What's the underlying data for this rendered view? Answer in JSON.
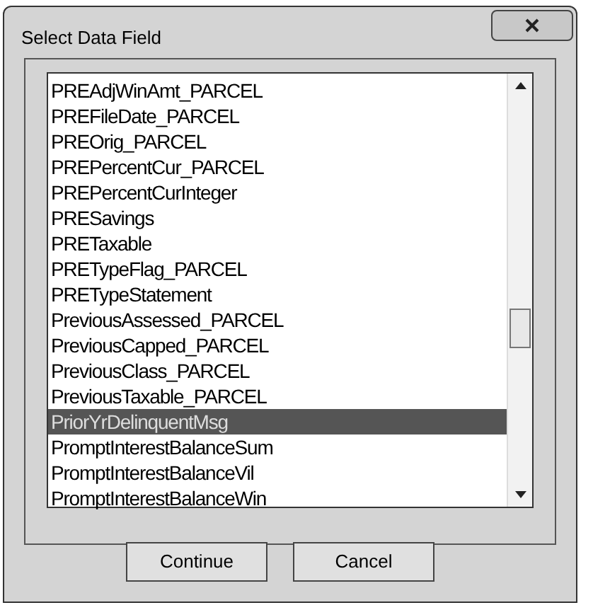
{
  "window": {
    "title": "Select Data Field"
  },
  "list": {
    "items": [
      {
        "label": "PREAdjWinAmt_PARCEL",
        "selected": false
      },
      {
        "label": "PREFileDate_PARCEL",
        "selected": false
      },
      {
        "label": "PREOrig_PARCEL",
        "selected": false
      },
      {
        "label": "PREPercentCur_PARCEL",
        "selected": false
      },
      {
        "label": "PREPercentCurInteger",
        "selected": false
      },
      {
        "label": "PRESavings",
        "selected": false
      },
      {
        "label": "PRETaxable",
        "selected": false
      },
      {
        "label": "PRETypeFlag_PARCEL",
        "selected": false
      },
      {
        "label": "PRETypeStatement",
        "selected": false
      },
      {
        "label": "PreviousAssessed_PARCEL",
        "selected": false
      },
      {
        "label": "PreviousCapped_PARCEL",
        "selected": false
      },
      {
        "label": "PreviousClass_PARCEL",
        "selected": false
      },
      {
        "label": "PreviousTaxable_PARCEL",
        "selected": false
      },
      {
        "label": "PriorYrDelinquentMsg",
        "selected": true
      },
      {
        "label": "PromptInterestBalanceSum",
        "selected": false
      },
      {
        "label": "PromptInterestBalanceVil",
        "selected": false
      },
      {
        "label": "PromptInterestBalanceWin",
        "selected": false
      }
    ]
  },
  "buttons": [
    "Continue",
    "Cancel"
  ]
}
